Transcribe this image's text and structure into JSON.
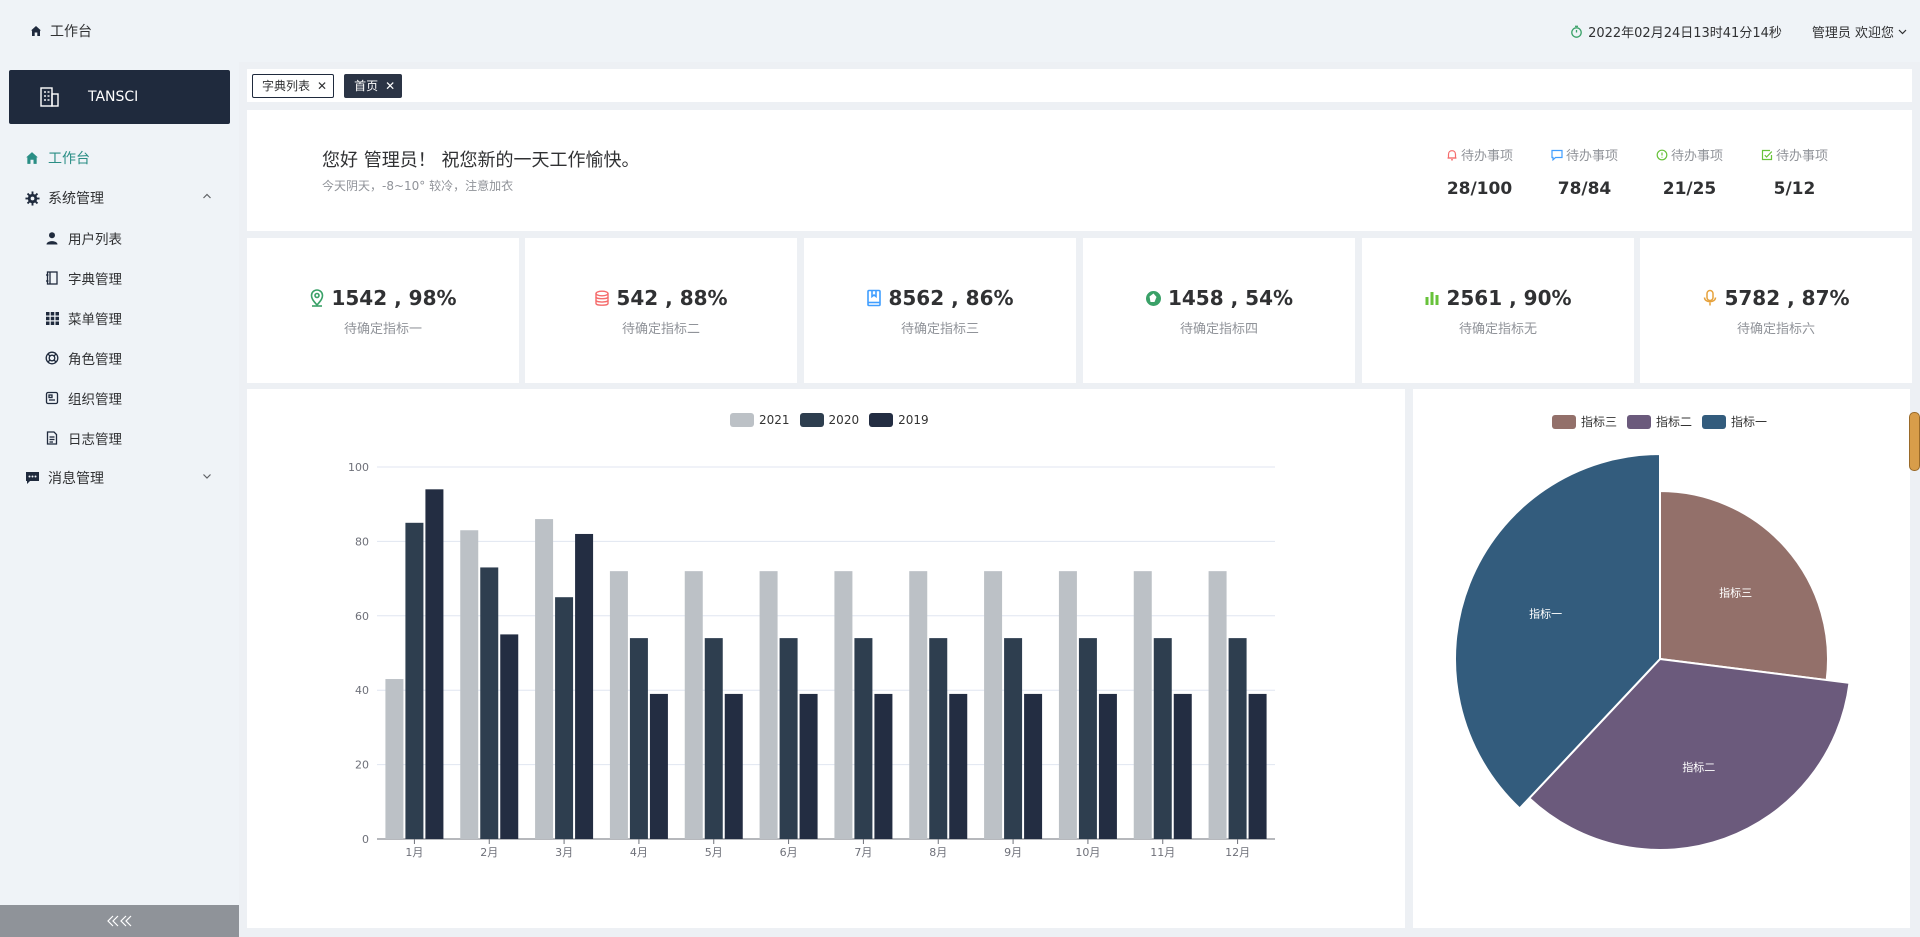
{
  "header": {
    "home_label": "工作台",
    "datetime": "2022年02月24日13时41分14秒",
    "user_label": "管理员 欢迎您"
  },
  "sidebar": {
    "logo_text": "TANSCI",
    "items": [
      {
        "label": "工作台",
        "icon": "home-icon",
        "level": "top",
        "active": true
      },
      {
        "label": "系统管理",
        "icon": "gear-icon",
        "level": "top",
        "expanded": true
      },
      {
        "label": "用户列表",
        "icon": "user-icon",
        "level": "sub"
      },
      {
        "label": "字典管理",
        "icon": "notebook-icon",
        "level": "sub"
      },
      {
        "label": "菜单管理",
        "icon": "grid-icon",
        "level": "sub"
      },
      {
        "label": "角色管理",
        "icon": "lifebuoy-icon",
        "level": "sub"
      },
      {
        "label": "组织管理",
        "icon": "org-icon",
        "level": "sub"
      },
      {
        "label": "日志管理",
        "icon": "document-icon",
        "level": "sub"
      },
      {
        "label": "消息管理",
        "icon": "message-icon",
        "level": "top",
        "expanded": false
      }
    ]
  },
  "tabs": [
    {
      "label": "字典列表",
      "active": false
    },
    {
      "label": "首页",
      "active": true
    }
  ],
  "welcome": {
    "greeting": "您好 管理员！ 祝您新的一天工作愉快。",
    "weather": "今天阴天，-8~10° 较冷，注意加衣",
    "todos": [
      {
        "label": "待办事项",
        "value": "28/100",
        "icon": "bell-icon",
        "color": "#f56c6c"
      },
      {
        "label": "待办事项",
        "value": "78/84",
        "icon": "chat-icon",
        "color": "#409eff"
      },
      {
        "label": "待办事项",
        "value": "21/25",
        "icon": "info-circle-icon",
        "color": "#67c23a"
      },
      {
        "label": "待办事项",
        "value": "5/12",
        "icon": "edit-icon",
        "color": "#67c23a"
      }
    ]
  },
  "stats": [
    {
      "value": "1542 , 98%",
      "label": "待确定指标一",
      "icon": "location-icon",
      "color": "#3aa168"
    },
    {
      "value": "542 , 88%",
      "label": "待确定指标二",
      "icon": "database-icon",
      "color": "#f56c6c"
    },
    {
      "value": "8562 , 86%",
      "label": "待确定指标三",
      "icon": "book-icon",
      "color": "#409eff"
    },
    {
      "value": "1458 , 54%",
      "label": "待确定指标四",
      "icon": "aperture-icon",
      "color": "#3aa168"
    },
    {
      "value": "2561 , 90%",
      "label": "待确定指标无",
      "icon": "bar-chart-icon",
      "color": "#67c23a"
    },
    {
      "value": "5782 , 87%",
      "label": "待确定指标六",
      "icon": "microphone-icon",
      "color": "#e6a23c"
    }
  ],
  "chart_data": [
    {
      "type": "bar",
      "categories": [
        "1月",
        "2月",
        "3月",
        "4月",
        "5月",
        "6月",
        "7月",
        "8月",
        "9月",
        "10月",
        "11月",
        "12月"
      ],
      "series": [
        {
          "name": "2021",
          "color": "#bcc1c6",
          "values": [
            43,
            83,
            86,
            72,
            72,
            72,
            72,
            72,
            72,
            72,
            72,
            72
          ]
        },
        {
          "name": "2020",
          "color": "#2e3e4f",
          "values": [
            85,
            73,
            65,
            54,
            54,
            54,
            54,
            54,
            54,
            54,
            54,
            54
          ]
        },
        {
          "name": "2019",
          "color": "#232d42",
          "values": [
            94,
            55,
            82,
            39,
            39,
            39,
            39,
            39,
            39,
            39,
            39,
            39
          ]
        }
      ],
      "yticks": [
        0,
        20,
        40,
        60,
        80,
        100
      ],
      "ylim": [
        0,
        100
      ],
      "legend": "top-center",
      "grid": true
    },
    {
      "type": "pie",
      "legend_order": [
        "指标三",
        "指标二",
        "指标一"
      ],
      "slices": [
        {
          "name": "指标三",
          "value": 27,
          "color": "#93706a"
        },
        {
          "name": "指标二",
          "value": 35,
          "color": "#6b5a7c"
        },
        {
          "name": "指标一",
          "value": 38,
          "color": "#335c7d"
        }
      ],
      "legend": "top-center"
    }
  ]
}
